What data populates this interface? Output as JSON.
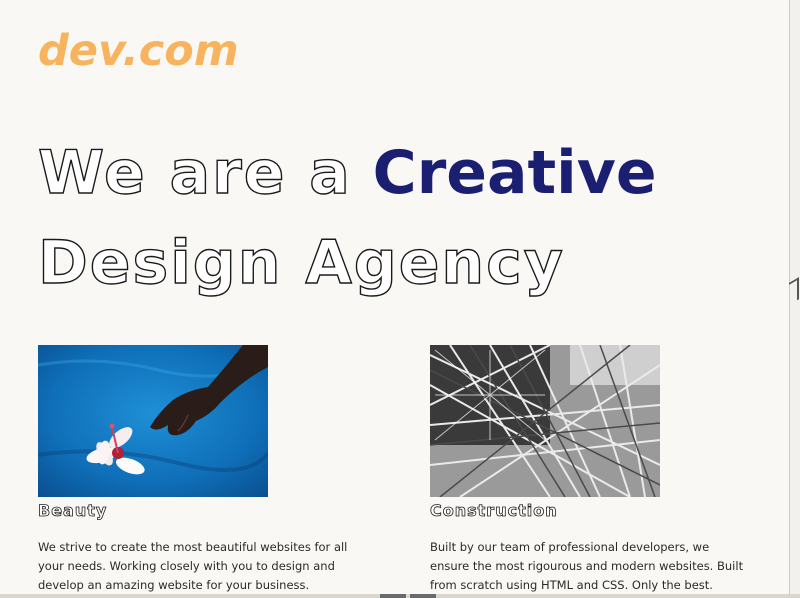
{
  "brand": {
    "logo_text": "dev.com",
    "logo_color": "#f7b35d"
  },
  "hero": {
    "line1_outline": "We are a",
    "line1_accent": "Creative",
    "line2_outline": "Design Agency",
    "accent_color": "#1b1f72"
  },
  "cards": [
    {
      "image_subject": "flower-in-water-image",
      "title": "Beauty",
      "text": "We strive to create the most beautiful websites for all your needs. Working closely with you to design and develop an amazing website for your business."
    },
    {
      "image_subject": "steel-structure-image",
      "title": "Construction",
      "text": "Built by our team of professional developers, we ensure the most rigourous and modern websites. Built from scratch using HTML and CSS. Only the best."
    }
  ]
}
